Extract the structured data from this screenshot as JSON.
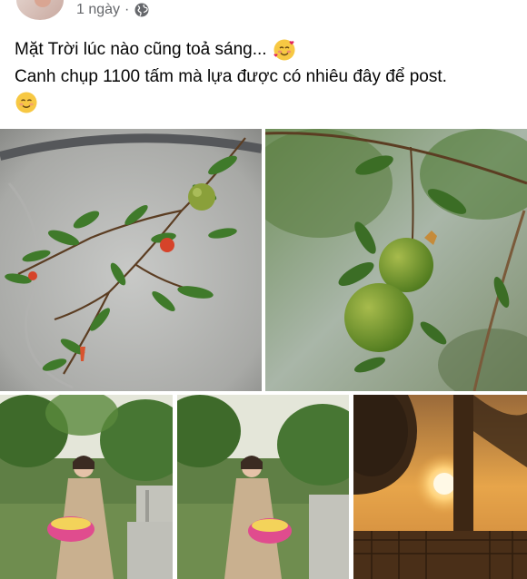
{
  "post": {
    "time_label": "1 ngày",
    "separator": "·",
    "privacy_icon": "globe-icon",
    "text_line1": "Mặt Trời lúc nào cũng toả sáng...",
    "text_line2": "Canh chụp 1100 tấm mà lựa được có nhiêu đây để post.",
    "emoji1": "smiling-face-with-hearts-icon",
    "emoji2": "smiling-face-icon"
  },
  "photos": [
    {
      "name": "photo-pomegranate-blossom-branch",
      "subject": "pomegranate branch with flowers against grey wall"
    },
    {
      "name": "photo-green-pomegranate-fruits",
      "subject": "two green pomegranate fruits"
    },
    {
      "name": "photo-woman-holding-basket-1",
      "subject": "woman with pink basket in garden"
    },
    {
      "name": "photo-woman-holding-basket-2",
      "subject": "woman with pink basket in garden"
    },
    {
      "name": "photo-sunset-garden",
      "subject": "sunset behind palm trees"
    }
  ],
  "colors": {
    "meta_text": "#65676b",
    "post_text": "#050505",
    "leaf_green": "#3f7a2a",
    "sunset_orange": "#e7a54a"
  }
}
